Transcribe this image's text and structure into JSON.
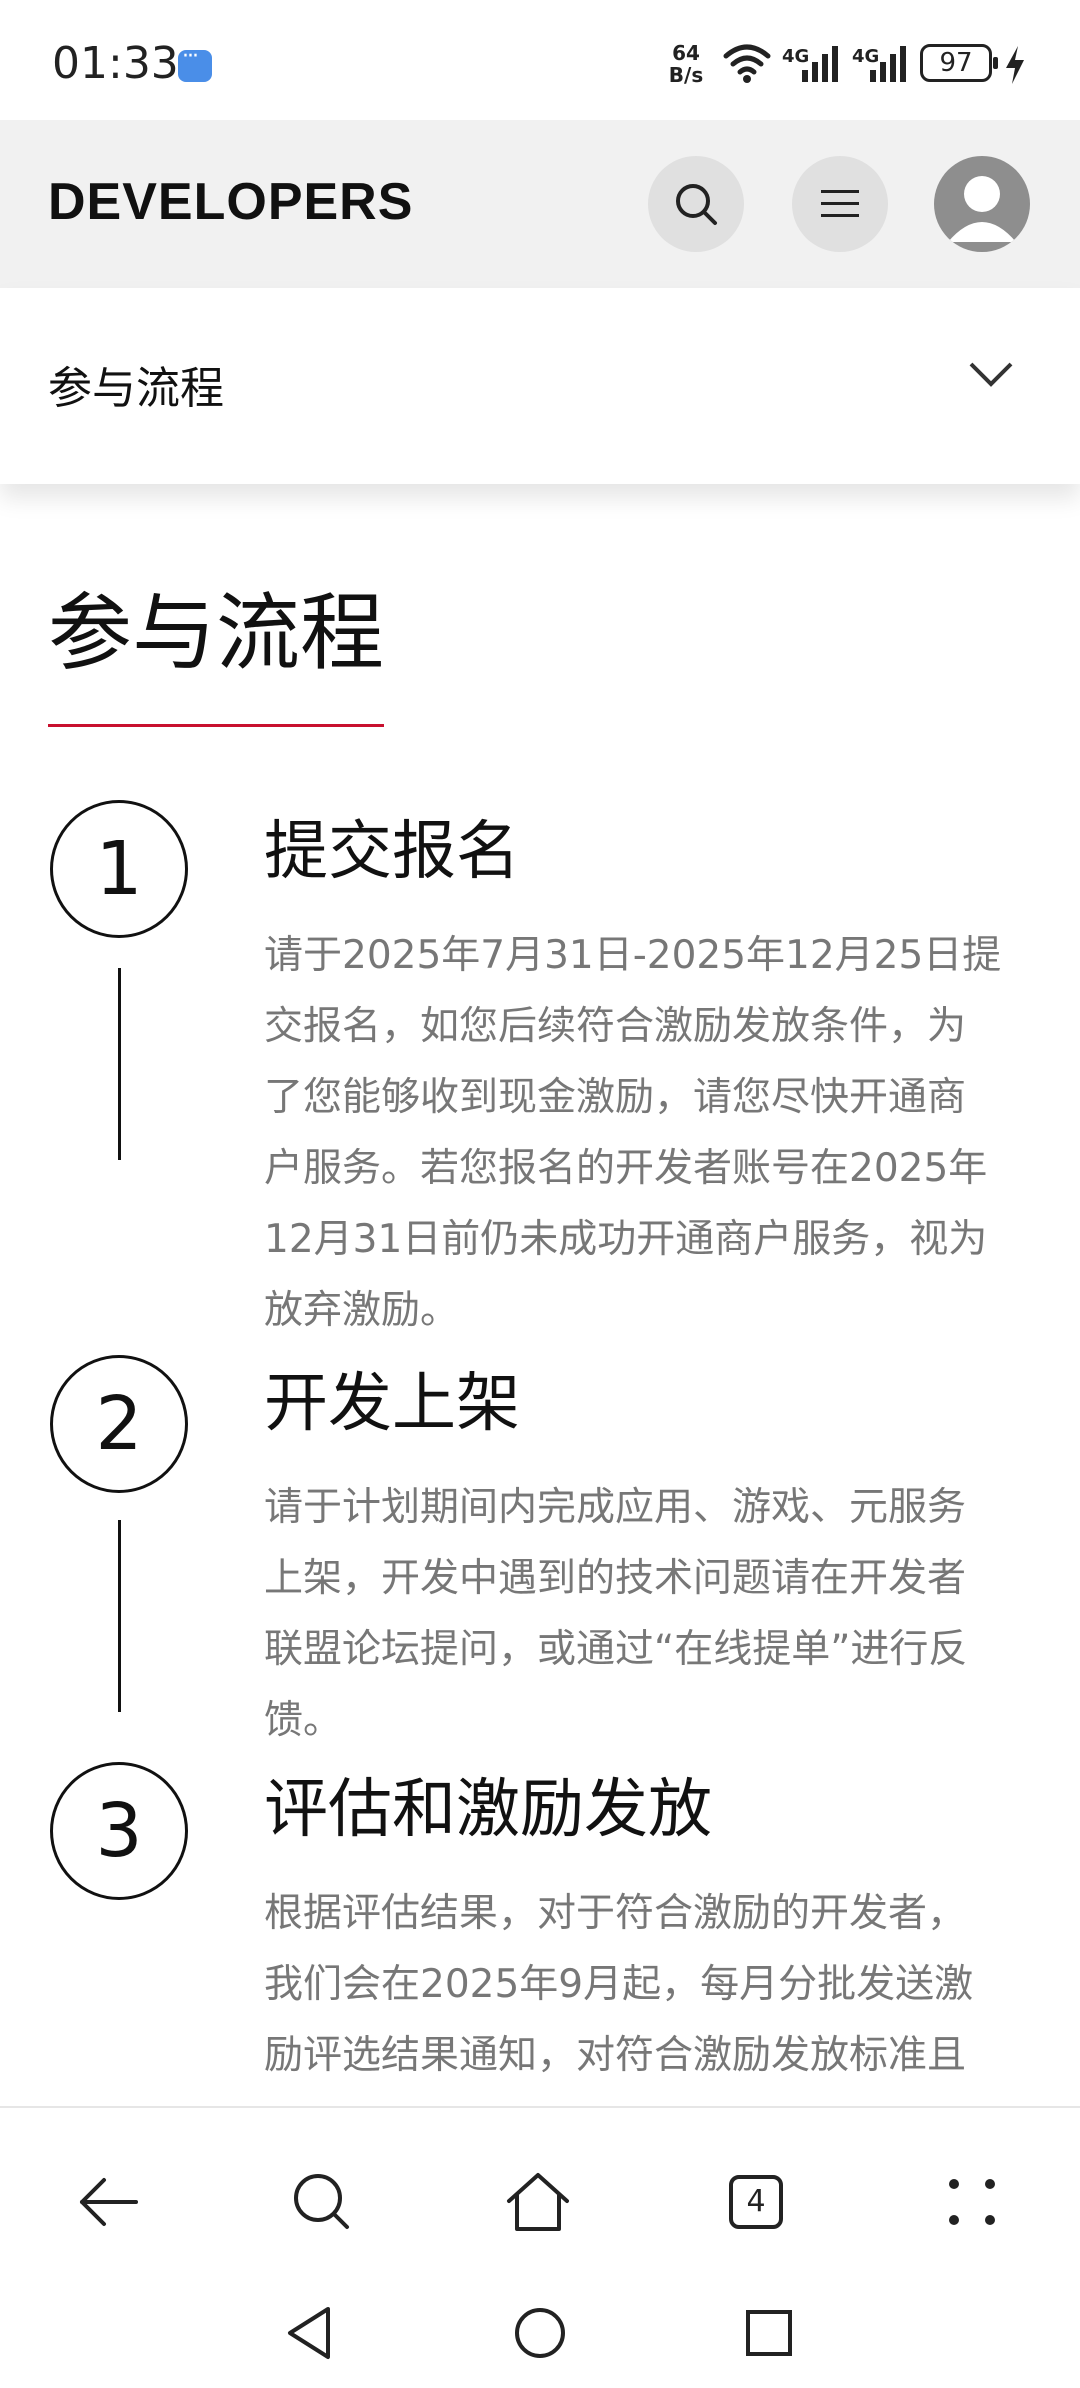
{
  "status_bar": {
    "time": "01:33",
    "net_speed_value": "64",
    "net_speed_unit": "B/s",
    "network_label_1": "4G",
    "network_label_2": "4G",
    "battery": "97",
    "icons": [
      "message-icon",
      "wifi-icon",
      "signal-icon",
      "signal-icon",
      "battery-icon",
      "charging-icon"
    ]
  },
  "header": {
    "logo": "DEVELOPERS",
    "icons": [
      "search-icon",
      "menu-icon",
      "avatar-icon"
    ]
  },
  "subnav": {
    "title": "参与流程",
    "icon": "chevron-down-icon"
  },
  "section": {
    "title": "参与流程",
    "accent_color": "#c8102e",
    "steps": [
      {
        "number": "1",
        "title": "提交报名",
        "lines": [
          "请于2025年7月31日-2025年12月25日提",
          "交报名，如您后续符合激励发放条件，为",
          "了您能够收到现金激励，请您尽快开通商",
          "户服务。若您报名的开发者账号在2025年",
          "12月31日前仍未成功开通商户服务，视为",
          "放弃激励。"
        ]
      },
      {
        "number": "2",
        "title": "开发上架",
        "lines": [
          "请于计划期间内完成应用、游戏、元服务",
          "上架，开发中遇到的技术问题请在开发者",
          "联盟论坛提问，或通过“在线提单”进行反",
          "馈。"
        ]
      },
      {
        "number": "3",
        "title": "评估和激励发放",
        "lines": [
          "根据评估结果，对于符合激励的开发者，",
          "我们会在2025年9月起，每月分批发送激",
          "励评选结果通知，对符合激励发放标准且"
        ]
      }
    ]
  },
  "browser_bar": {
    "tab_count": "4",
    "icons": [
      "back-arrow-icon",
      "search-icon",
      "home-icon",
      "tabs-icon",
      "more-icon"
    ]
  },
  "system_nav": {
    "icons": [
      "back-triangle-icon",
      "home-circle-icon",
      "recents-square-icon"
    ]
  }
}
